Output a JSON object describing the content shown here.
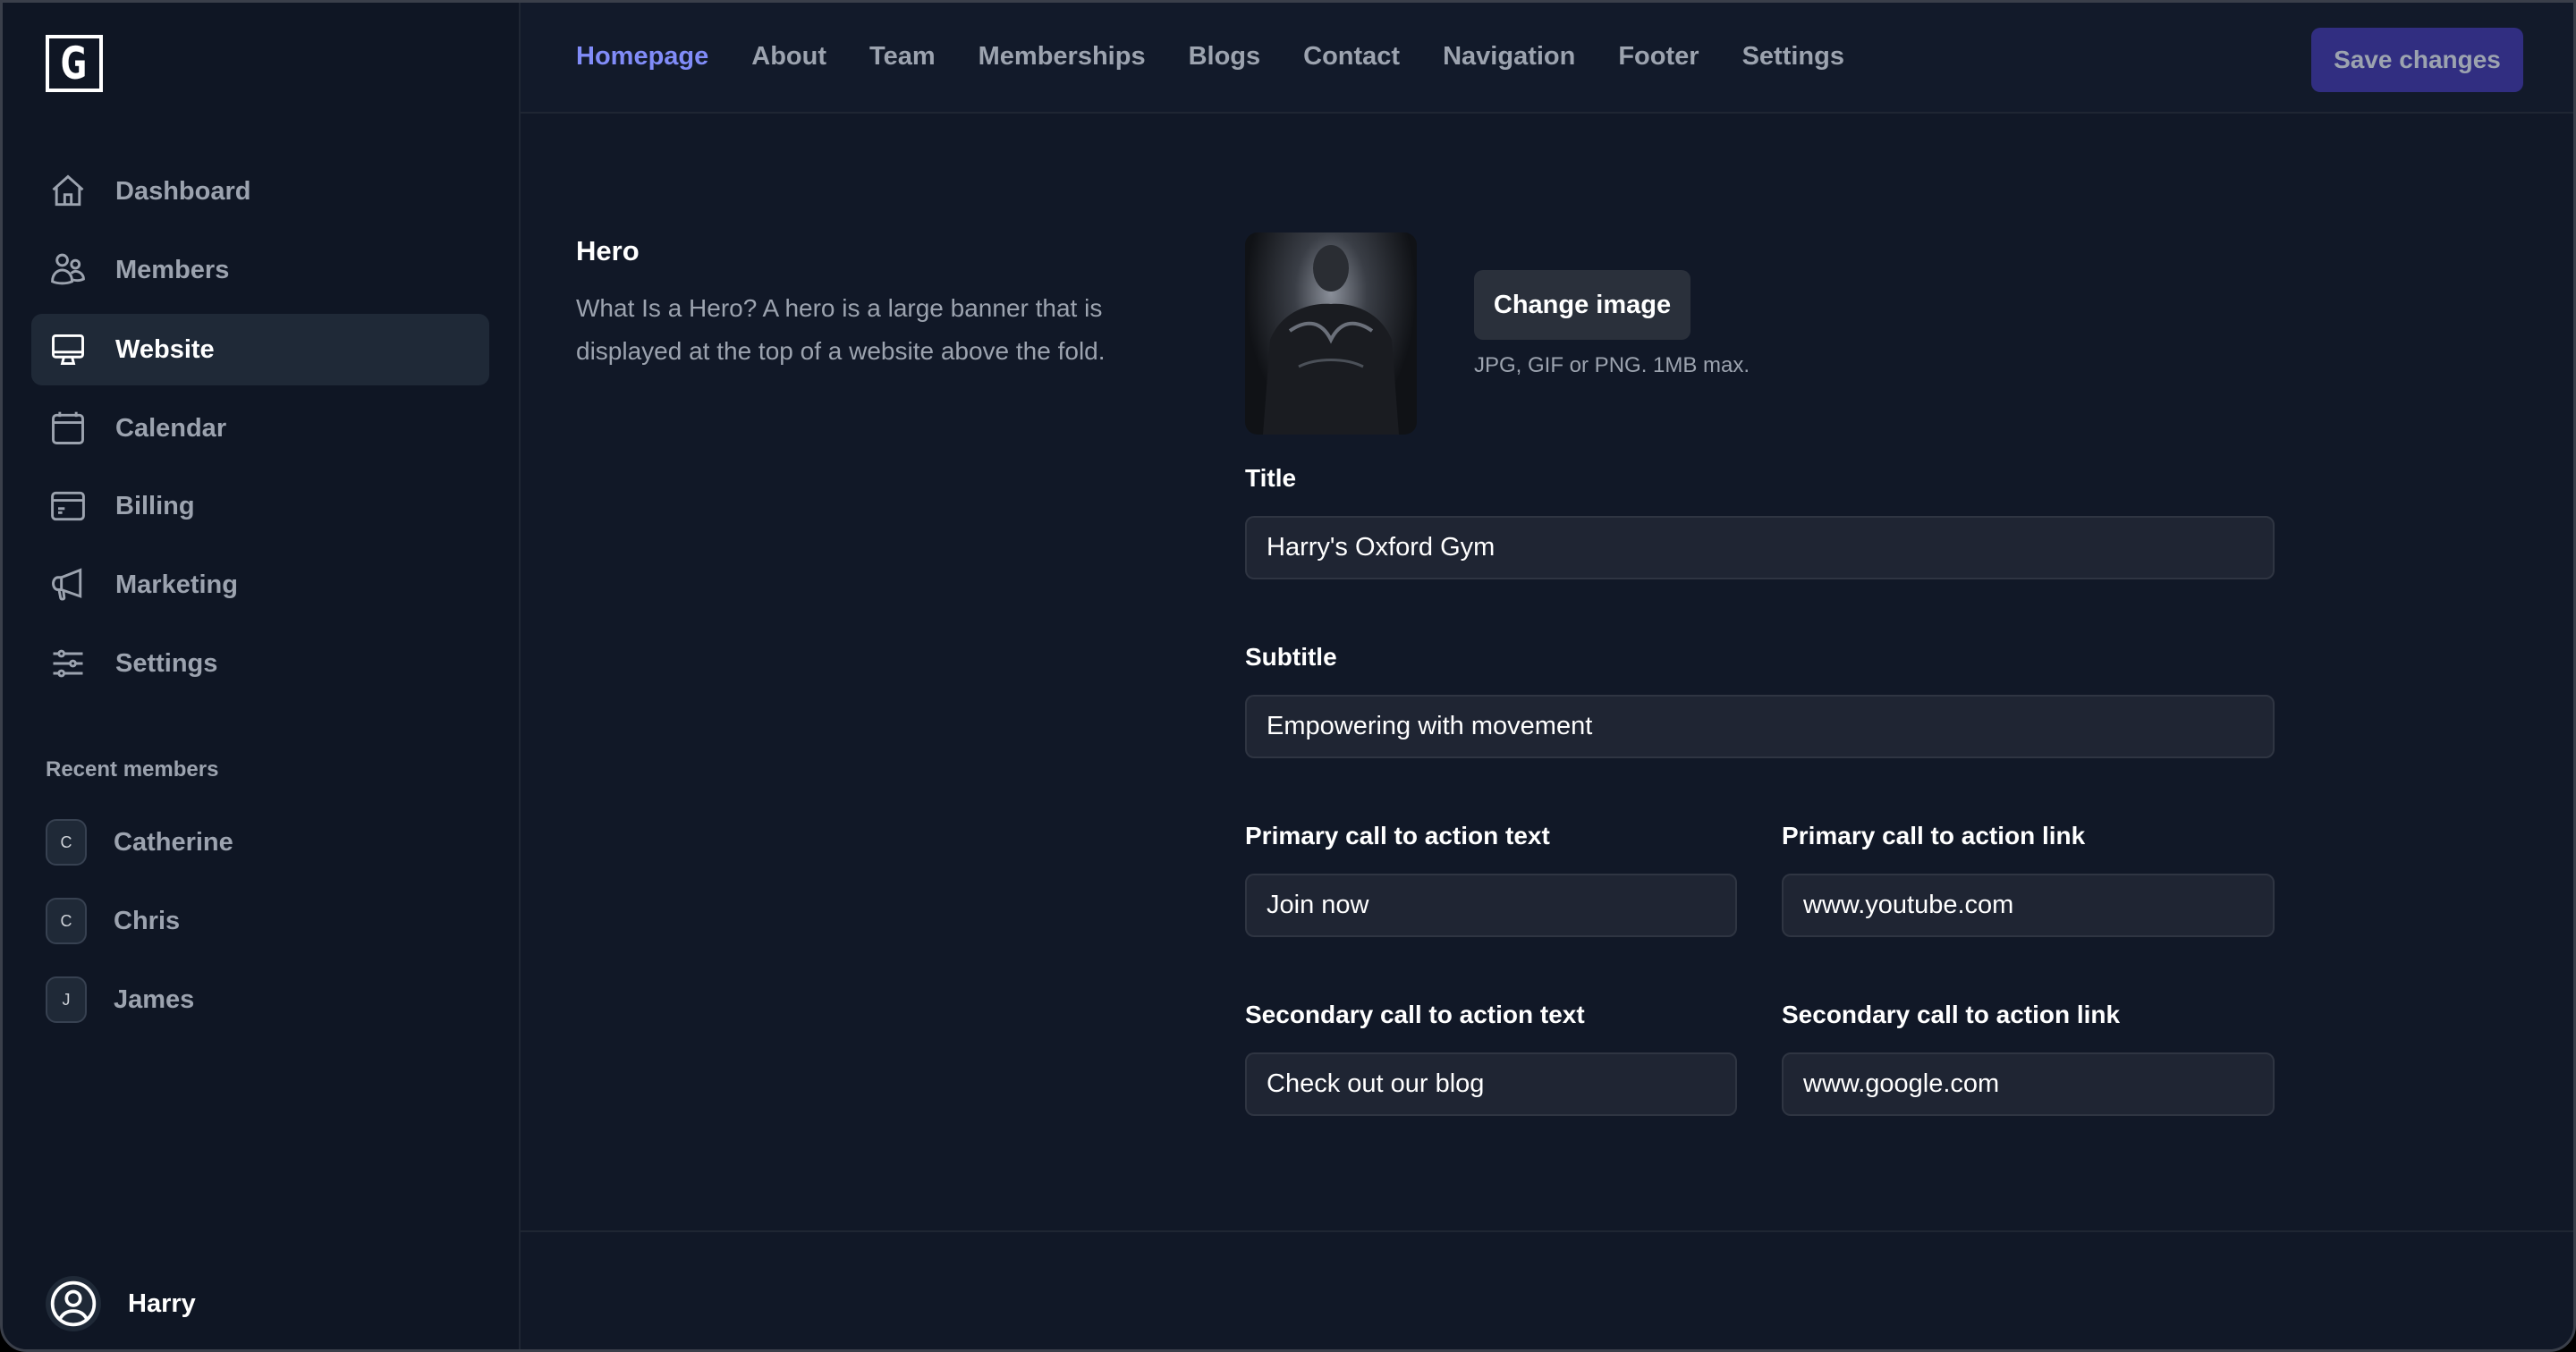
{
  "app": {
    "logo_letter": "G"
  },
  "sidebar": {
    "items": [
      {
        "label": "Dashboard",
        "icon": "home-icon",
        "active": false
      },
      {
        "label": "Members",
        "icon": "users-icon",
        "active": false
      },
      {
        "label": "Website",
        "icon": "monitor-icon",
        "active": true
      },
      {
        "label": "Calendar",
        "icon": "calendar-icon",
        "active": false
      },
      {
        "label": "Billing",
        "icon": "credit-card-icon",
        "active": false
      },
      {
        "label": "Marketing",
        "icon": "megaphone-icon",
        "active": false
      },
      {
        "label": "Settings",
        "icon": "sliders-icon",
        "active": false
      }
    ],
    "recent_label": "Recent members",
    "recent_members": [
      {
        "initial": "C",
        "name": "Catherine"
      },
      {
        "initial": "C",
        "name": "Chris"
      },
      {
        "initial": "J",
        "name": "James"
      }
    ],
    "user": {
      "name": "Harry",
      "icon": "user-circle-icon"
    }
  },
  "header": {
    "tabs": [
      {
        "label": "Homepage",
        "active": true
      },
      {
        "label": "About",
        "active": false
      },
      {
        "label": "Team",
        "active": false
      },
      {
        "label": "Memberships",
        "active": false
      },
      {
        "label": "Blogs",
        "active": false
      },
      {
        "label": "Contact",
        "active": false
      },
      {
        "label": "Navigation",
        "active": false
      },
      {
        "label": "Footer",
        "active": false
      },
      {
        "label": "Settings",
        "active": false
      }
    ],
    "save_label": "Save changes"
  },
  "hero": {
    "title": "Hero",
    "description": "What Is a Hero? A hero is a large banner that is displayed at the top of a website above the fold.",
    "change_image_label": "Change image",
    "image_hint": "JPG, GIF or PNG. 1MB max.",
    "fields": {
      "title": {
        "label": "Title",
        "value": "Harry's Oxford Gym"
      },
      "subtitle": {
        "label": "Subtitle",
        "value": "Empowering with movement"
      },
      "primary_text": {
        "label": "Primary call to action text",
        "value": "Join now"
      },
      "primary_link": {
        "label": "Primary call to action link",
        "value": "www.youtube.com"
      },
      "secondary_text": {
        "label": "Secondary call to action text",
        "value": "Check out our blog"
      },
      "secondary_link": {
        "label": "Secondary call to action link",
        "value": "www.google.com"
      }
    }
  },
  "colors": {
    "accent": "#818cf8",
    "save_button_bg": "#312e81",
    "sidebar_bg": "#0f1624",
    "content_bg": "#111827",
    "input_bg": "#1f2533"
  }
}
